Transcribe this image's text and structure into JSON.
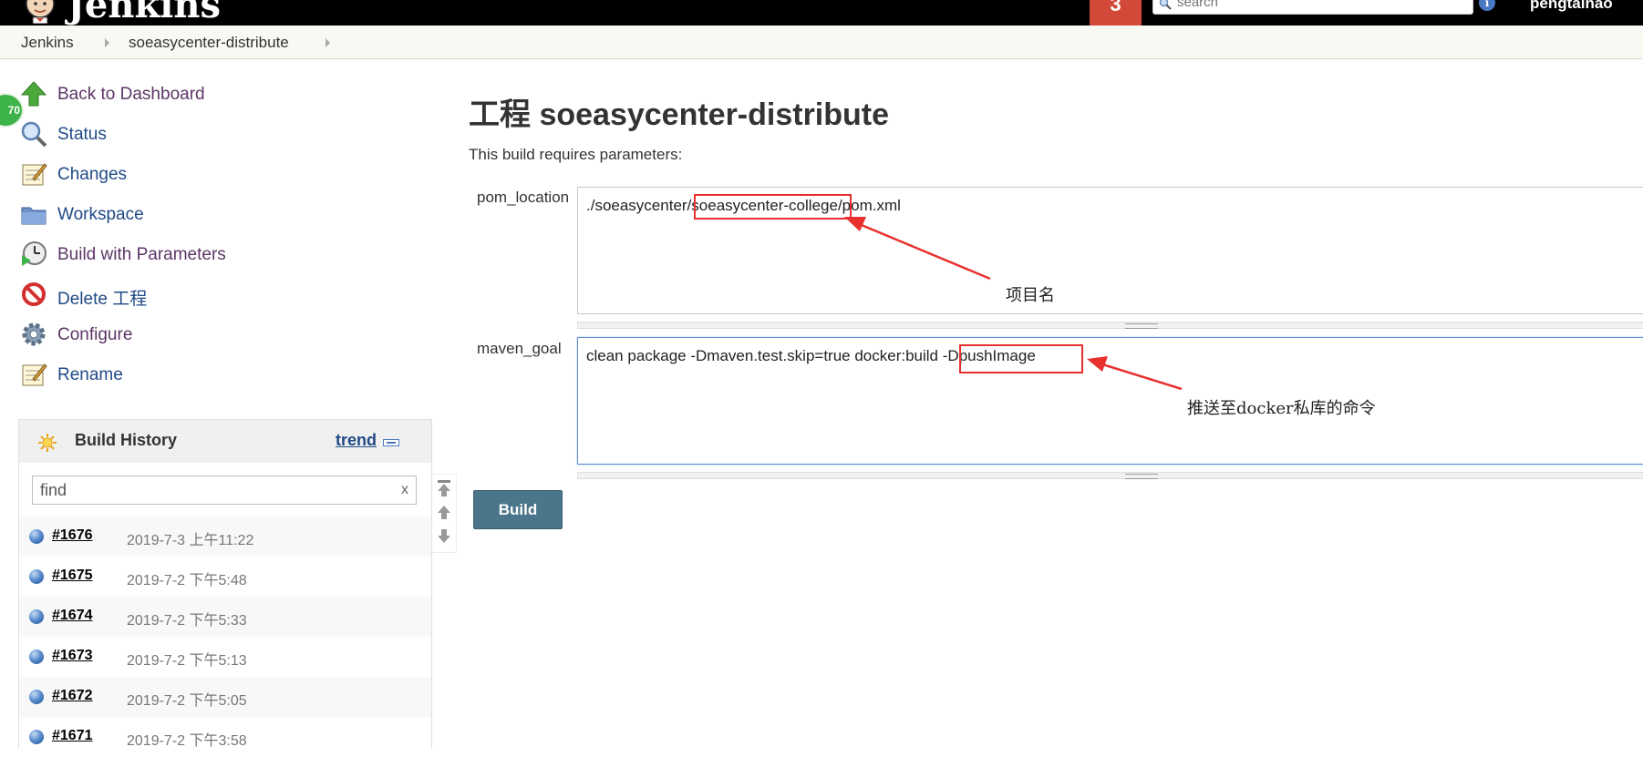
{
  "header": {
    "logo_text": "Jenkins",
    "notifications_count": "3",
    "search": {
      "placeholder": "search"
    },
    "user_name": "pengtainao",
    "colors": {
      "background": "#000000",
      "notification": "#d24939"
    }
  },
  "breadcrumb": {
    "items": [
      "Jenkins",
      "soeasycenter-distribute"
    ]
  },
  "sidebar": {
    "health_badge": "70",
    "tasks": [
      {
        "label": "Back to Dashboard",
        "icon": "up-arrow-icon"
      },
      {
        "label": "Status",
        "icon": "magnifier-icon"
      },
      {
        "label": "Changes",
        "icon": "notepad-icon"
      },
      {
        "label": "Workspace",
        "icon": "folder-icon"
      },
      {
        "label": "Build with Parameters",
        "icon": "clock-play-icon"
      },
      {
        "label": "Delete 工程",
        "icon": "no-entry-icon"
      },
      {
        "label": "Configure",
        "icon": "gear-icon"
      },
      {
        "label": "Rename",
        "icon": "notepad-icon"
      }
    ]
  },
  "build_history": {
    "title": "Build History",
    "trend_label": "trend",
    "filter": {
      "value": "find",
      "clear_label": "x"
    },
    "builds": [
      {
        "number": "#1676",
        "date": "2019-7-3 上午11:22"
      },
      {
        "number": "#1675",
        "date": "2019-7-2 下午5:48"
      },
      {
        "number": "#1674",
        "date": "2019-7-2 下午5:33"
      },
      {
        "number": "#1673",
        "date": "2019-7-2 下午5:13"
      },
      {
        "number": "#1672",
        "date": "2019-7-2 下午5:05"
      },
      {
        "number": "#1671",
        "date": "2019-7-2 下午3:58"
      }
    ]
  },
  "main": {
    "title": "工程 soeasycenter-distribute",
    "requires_text": "This build requires parameters:",
    "params": [
      {
        "name": "pom_location",
        "value_parts": [
          "./soeasycenter/",
          "soeasycenter-college",
          "/pom.xml"
        ]
      },
      {
        "name": "maven_goal",
        "value_parts": [
          "clean package  -Dmaven.test.skip=true docker:build",
          "-DpushImage"
        ]
      }
    ],
    "build_button_label": "Build"
  },
  "annotations": {
    "project_name": "项目名",
    "push_command": "推送至docker私库的命令",
    "color": "#e8312f"
  }
}
